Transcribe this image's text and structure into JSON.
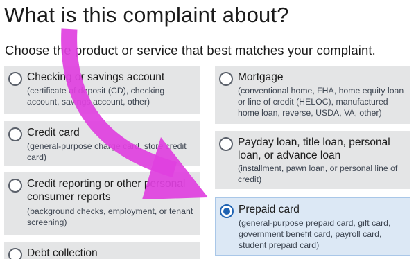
{
  "page": {
    "title": "What is this complaint about?",
    "subtitle": "Choose the product or service that best matches your complaint."
  },
  "options": {
    "checking": {
      "label": "Checking or savings account",
      "description": "(certificate of deposit (CD), checking account, savings account, other)",
      "selected": false
    },
    "credit_card": {
      "label": "Credit card",
      "description": "(general-purpose charge card, store credit card)",
      "selected": false
    },
    "credit_reporting": {
      "label": "Credit reporting or other personal consumer reports",
      "description": "(background checks, employment, or tenant screening)",
      "selected": false
    },
    "debt_collection": {
      "label": "Debt collection",
      "selected": false
    },
    "mortgage": {
      "label": "Mortgage",
      "description": "(conventional home, FHA, home equity loan or line of credit (HELOC), manufactured home loan, reverse, USDA, VA, other)",
      "selected": false
    },
    "payday": {
      "label": "Payday loan, title loan, personal loan, or advance loan",
      "description": "(installment, pawn loan, or personal line of credit)",
      "selected": false
    },
    "prepaid": {
      "label": "Prepaid card",
      "description": "(general-purpose prepaid card, gift card, government benefit card, payroll card, student prepaid card)",
      "selected": true
    }
  },
  "colors": {
    "card_bg": "#e4e5e6",
    "selected_bg": "#dce8f5",
    "radio_checked": "#1f63b3",
    "annotation_arrow": "#e040e0"
  }
}
